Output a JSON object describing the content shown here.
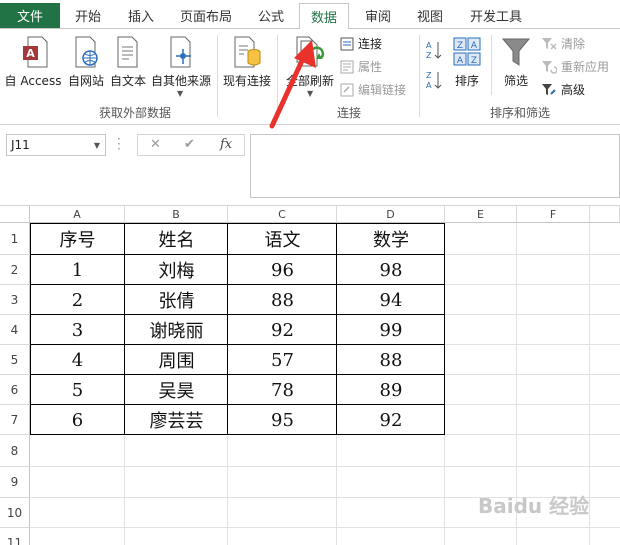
{
  "ribbon": {
    "tabs": [
      {
        "label": "文件",
        "active": false
      },
      {
        "label": "开始",
        "active": false
      },
      {
        "label": "插入",
        "active": false
      },
      {
        "label": "页面布局",
        "active": false
      },
      {
        "label": "公式",
        "active": false
      },
      {
        "label": "数据",
        "active": true
      },
      {
        "label": "审阅",
        "active": false
      },
      {
        "label": "视图",
        "active": false
      },
      {
        "label": "开发工具",
        "active": false
      }
    ],
    "groups": {
      "external": {
        "label": "获取外部数据",
        "buttons": [
          "自 Access",
          "自网站",
          "自文本",
          "自其他来源"
        ]
      },
      "existing": {
        "label": "现有连接"
      },
      "connections": {
        "label": "连接",
        "refresh_all": "全部刷新",
        "connections": "连接",
        "properties": "属性",
        "edit_links": "编辑链接"
      },
      "sort_filter": {
        "label": "排序和筛选",
        "sort": "排序",
        "filter": "筛选",
        "clear": "清除",
        "reapply": "重新应用",
        "advanced": "高级"
      }
    }
  },
  "formula_bar": {
    "name_box": "J11",
    "fx": "fx",
    "cancel": "✕",
    "enter": "✔",
    "value": ""
  },
  "sheet": {
    "columns": [
      "A",
      "B",
      "C",
      "D",
      "E",
      "F"
    ],
    "rows": [
      "1",
      "2",
      "3",
      "4",
      "5",
      "6",
      "7",
      "8",
      "9",
      "10",
      "11"
    ],
    "header": [
      "序号",
      "姓名",
      "语文",
      "数学"
    ],
    "data": [
      [
        "1",
        "刘梅",
        "96",
        "98"
      ],
      [
        "2",
        "张倩",
        "88",
        "94"
      ],
      [
        "3",
        "谢晓丽",
        "92",
        "99"
      ],
      [
        "4",
        "周围",
        "57",
        "88"
      ],
      [
        "5",
        "吴昊",
        "78",
        "89"
      ],
      [
        "6",
        "廖芸芸",
        "95",
        "92"
      ]
    ]
  },
  "watermark": "Baidu 经验",
  "colors": {
    "excel_green": "#217346",
    "annotation_red": "#e8322b"
  }
}
